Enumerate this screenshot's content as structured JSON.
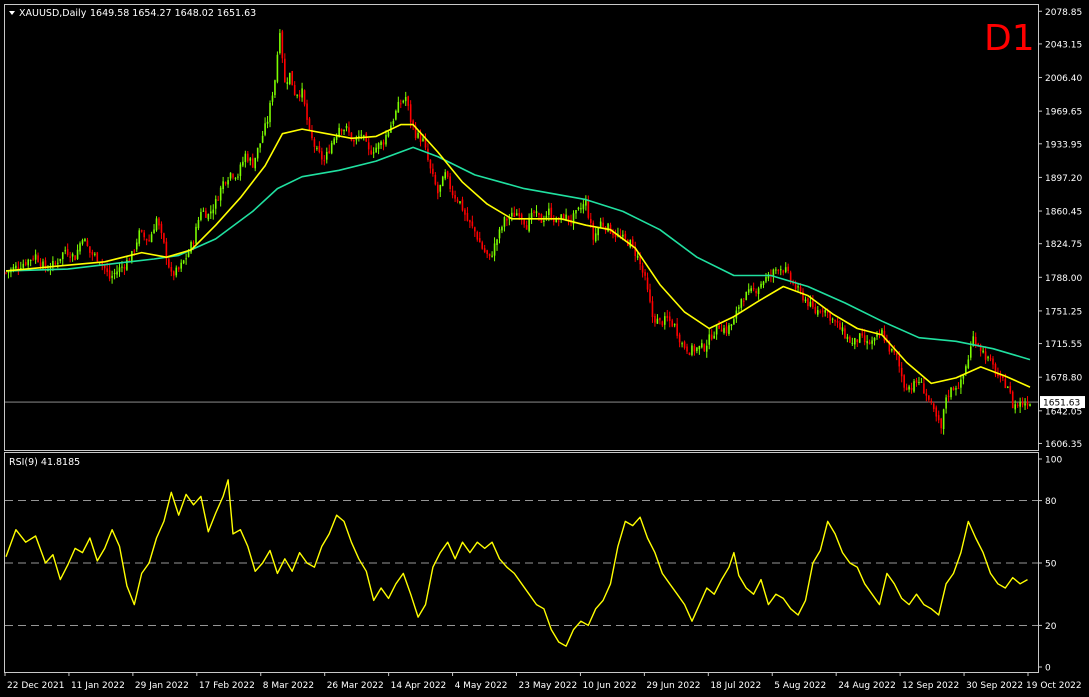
{
  "header": {
    "symbol": "XAUUSD,Daily",
    "ohlc": "1649.58 1654.27 1648.02 1651.63",
    "timeframe_badge": "D1"
  },
  "colors": {
    "background": "#000000",
    "frame": "#c8c8c8",
    "bull": "#7CFC00",
    "bear": "#FF0000",
    "ma_fast": "#FFFF00",
    "ma_slow": "#20E0A0",
    "rsi": "#FFFF00",
    "badge": "#FF0000",
    "price_line": "#A0A0A0"
  },
  "chart_data": [
    {
      "type": "candlestick",
      "title": "XAUUSD,Daily",
      "ylim": [
        1600,
        2085
      ],
      "yticks": [
        "2078.85",
        "2043.15",
        "2006.40",
        "1969.65",
        "1933.95",
        "1897.20",
        "1860.45",
        "1824.75",
        "1788.00",
        "1751.25",
        "1715.55",
        "1678.80",
        "1642.05",
        "1606.35"
      ],
      "last_price": "1651.63",
      "x_labels": [
        "22 Dec 2021",
        "11 Jan 2022",
        "29 Jan 2022",
        "17 Feb 2022",
        "8 Mar 2022",
        "26 Mar 2022",
        "14 Apr 2022",
        "4 May 2022",
        "23 May 2022",
        "10 Jun 2022",
        "29 Jun 2022",
        "18 Jul 2022",
        "5 Aug 2022",
        "24 Aug 2022",
        "12 Sep 2022",
        "30 Sep 2022",
        "19 Oct 2022"
      ],
      "close_path": [
        [
          0,
          1793
        ],
        [
          8,
          1805
        ],
        [
          12,
          1812
        ],
        [
          16,
          1797
        ],
        [
          20,
          1803
        ],
        [
          24,
          1818
        ],
        [
          28,
          1810
        ],
        [
          31,
          1833
        ],
        [
          34,
          1815
        ],
        [
          38,
          1808
        ],
        [
          42,
          1787
        ],
        [
          45,
          1795
        ],
        [
          48,
          1802
        ],
        [
          51,
          1812
        ],
        [
          54,
          1836
        ],
        [
          58,
          1828
        ],
        [
          61,
          1852
        ],
        [
          64,
          1823
        ],
        [
          67,
          1790
        ],
        [
          70,
          1796
        ],
        [
          73,
          1810
        ],
        [
          76,
          1829
        ],
        [
          79,
          1862
        ],
        [
          82,
          1856
        ],
        [
          85,
          1870
        ],
        [
          88,
          1892
        ],
        [
          91,
          1902
        ],
        [
          94,
          1900
        ],
        [
          97,
          1922
        ],
        [
          100,
          1912
        ],
        [
          103,
          1935
        ],
        [
          106,
          1960
        ],
        [
          109,
          2005
        ],
        [
          111,
          2060
        ],
        [
          113,
          2000
        ],
        [
          115,
          2010
        ],
        [
          117,
          1990
        ],
        [
          120,
          1990
        ],
        [
          123,
          1945
        ],
        [
          126,
          1925
        ],
        [
          129,
          1915
        ],
        [
          132,
          1935
        ],
        [
          135,
          1953
        ],
        [
          138,
          1950
        ],
        [
          141,
          1935
        ],
        [
          144,
          1945
        ],
        [
          147,
          1925
        ],
        [
          150,
          1930
        ],
        [
          153,
          1937
        ],
        [
          156,
          1955
        ],
        [
          159,
          1975
        ],
        [
          162,
          1985
        ],
        [
          164,
          1960
        ],
        [
          166,
          1945
        ],
        [
          169,
          1937
        ],
        [
          172,
          1905
        ],
        [
          175,
          1880
        ],
        [
          178,
          1900
        ],
        [
          181,
          1880
        ],
        [
          184,
          1870
        ],
        [
          187,
          1850
        ],
        [
          190,
          1838
        ],
        [
          193,
          1820
        ],
        [
          196,
          1808
        ],
        [
          199,
          1830
        ],
        [
          202,
          1850
        ],
        [
          205,
          1855
        ],
        [
          208,
          1860
        ],
        [
          211,
          1845
        ],
        [
          214,
          1858
        ],
        [
          217,
          1850
        ],
        [
          220,
          1860
        ],
        [
          223,
          1848
        ],
        [
          226,
          1855
        ],
        [
          229,
          1850
        ],
        [
          232,
          1860
        ],
        [
          235,
          1870
        ],
        [
          238,
          1830
        ],
        [
          241,
          1848
        ],
        [
          244,
          1842
        ],
        [
          247,
          1835
        ],
        [
          250,
          1830
        ],
        [
          253,
          1825
        ],
        [
          256,
          1810
        ],
        [
          259,
          1785
        ],
        [
          262,
          1745
        ],
        [
          265,
          1738
        ],
        [
          268,
          1742
        ],
        [
          271,
          1735
        ],
        [
          274,
          1715
        ],
        [
          277,
          1708
        ],
        [
          280,
          1710
        ],
        [
          283,
          1712
        ],
        [
          286,
          1725
        ],
        [
          289,
          1735
        ],
        [
          292,
          1730
        ],
        [
          295,
          1740
        ],
        [
          298,
          1765
        ],
        [
          301,
          1770
        ],
        [
          304,
          1775
        ],
        [
          307,
          1785
        ],
        [
          310,
          1790
        ],
        [
          313,
          1800
        ],
        [
          316,
          1795
        ],
        [
          319,
          1780
        ],
        [
          322,
          1770
        ],
        [
          325,
          1760
        ],
        [
          328,
          1750
        ],
        [
          331,
          1755
        ],
        [
          334,
          1745
        ],
        [
          337,
          1735
        ],
        [
          340,
          1725
        ],
        [
          343,
          1715
        ],
        [
          346,
          1722
        ],
        [
          349,
          1715
        ],
        [
          352,
          1718
        ],
        [
          355,
          1728
        ],
        [
          358,
          1710
        ],
        [
          361,
          1700
        ],
        [
          364,
          1670
        ],
        [
          367,
          1668
        ],
        [
          370,
          1675
        ],
        [
          373,
          1660
        ],
        [
          376,
          1640
        ],
        [
          379,
          1622
        ],
        [
          381,
          1658
        ],
        [
          384,
          1668
        ],
        [
          387,
          1672
        ],
        [
          390,
          1700
        ],
        [
          392,
          1722
        ],
        [
          394,
          1715
        ],
        [
          397,
          1702
        ],
        [
          400,
          1690
        ],
        [
          403,
          1675
        ],
        [
          406,
          1670
        ],
        [
          408,
          1648
        ],
        [
          411,
          1650
        ],
        [
          414,
          1652
        ]
      ],
      "ma_fast": [
        [
          0,
          1795
        ],
        [
          20,
          1800
        ],
        [
          40,
          1805
        ],
        [
          55,
          1815
        ],
        [
          65,
          1810
        ],
        [
          75,
          1818
        ],
        [
          85,
          1845
        ],
        [
          95,
          1875
        ],
        [
          105,
          1910
        ],
        [
          112,
          1945
        ],
        [
          120,
          1950
        ],
        [
          130,
          1945
        ],
        [
          140,
          1940
        ],
        [
          150,
          1942
        ],
        [
          160,
          1955
        ],
        [
          165,
          1955
        ],
        [
          175,
          1925
        ],
        [
          185,
          1892
        ],
        [
          195,
          1868
        ],
        [
          205,
          1852
        ],
        [
          215,
          1852
        ],
        [
          225,
          1852
        ],
        [
          235,
          1845
        ],
        [
          245,
          1840
        ],
        [
          255,
          1820
        ],
        [
          265,
          1780
        ],
        [
          275,
          1750
        ],
        [
          285,
          1732
        ],
        [
          295,
          1745
        ],
        [
          305,
          1762
        ],
        [
          315,
          1778
        ],
        [
          325,
          1768
        ],
        [
          335,
          1748
        ],
        [
          345,
          1732
        ],
        [
          355,
          1725
        ],
        [
          365,
          1695
        ],
        [
          375,
          1672
        ],
        [
          385,
          1678
        ],
        [
          395,
          1690
        ],
        [
          405,
          1680
        ],
        [
          415,
          1668
        ]
      ],
      "ma_slow": [
        [
          0,
          1795
        ],
        [
          25,
          1797
        ],
        [
          50,
          1805
        ],
        [
          60,
          1808
        ],
        [
          70,
          1812
        ],
        [
          85,
          1830
        ],
        [
          100,
          1860
        ],
        [
          110,
          1885
        ],
        [
          120,
          1898
        ],
        [
          135,
          1905
        ],
        [
          150,
          1915
        ],
        [
          165,
          1930
        ],
        [
          175,
          1920
        ],
        [
          190,
          1900
        ],
        [
          210,
          1885
        ],
        [
          235,
          1873
        ],
        [
          250,
          1860
        ],
        [
          265,
          1840
        ],
        [
          280,
          1810
        ],
        [
          295,
          1790
        ],
        [
          310,
          1790
        ],
        [
          325,
          1778
        ],
        [
          340,
          1760
        ],
        [
          355,
          1740
        ],
        [
          370,
          1722
        ],
        [
          385,
          1718
        ],
        [
          400,
          1710
        ],
        [
          415,
          1698
        ]
      ]
    },
    {
      "type": "line",
      "title": "RSI(9) 41.8185",
      "ylim": [
        0,
        100
      ],
      "yticks": [
        "100",
        "80",
        "50",
        "20",
        "0"
      ],
      "levels": [
        80,
        50,
        20
      ],
      "values": [
        [
          0,
          53
        ],
        [
          4,
          66
        ],
        [
          8,
          60
        ],
        [
          12,
          63
        ],
        [
          16,
          50
        ],
        [
          19,
          54
        ],
        [
          22,
          42
        ],
        [
          25,
          49
        ],
        [
          28,
          57
        ],
        [
          31,
          55
        ],
        [
          34,
          62
        ],
        [
          37,
          51
        ],
        [
          40,
          57
        ],
        [
          43,
          66
        ],
        [
          46,
          58
        ],
        [
          49,
          39
        ],
        [
          52,
          30
        ],
        [
          55,
          45
        ],
        [
          58,
          50
        ],
        [
          61,
          62
        ],
        [
          64,
          70
        ],
        [
          67,
          84
        ],
        [
          70,
          73
        ],
        [
          73,
          83
        ],
        [
          76,
          78
        ],
        [
          79,
          82
        ],
        [
          82,
          65
        ],
        [
          85,
          74
        ],
        [
          88,
          82
        ],
        [
          90,
          90
        ],
        [
          92,
          64
        ],
        [
          95,
          66
        ],
        [
          98,
          58
        ],
        [
          101,
          46
        ],
        [
          104,
          50
        ],
        [
          107,
          56
        ],
        [
          110,
          45
        ],
        [
          113,
          52
        ],
        [
          116,
          46
        ],
        [
          119,
          55
        ],
        [
          122,
          50
        ],
        [
          125,
          48
        ],
        [
          128,
          58
        ],
        [
          131,
          64
        ],
        [
          134,
          73
        ],
        [
          137,
          70
        ],
        [
          140,
          60
        ],
        [
          143,
          52
        ],
        [
          146,
          46
        ],
        [
          149,
          32
        ],
        [
          152,
          38
        ],
        [
          155,
          33
        ],
        [
          158,
          40
        ],
        [
          161,
          45
        ],
        [
          164,
          35
        ],
        [
          167,
          24
        ],
        [
          170,
          30
        ],
        [
          173,
          48
        ],
        [
          176,
          55
        ],
        [
          179,
          60
        ],
        [
          182,
          52
        ],
        [
          185,
          60
        ],
        [
          188,
          55
        ],
        [
          191,
          60
        ],
        [
          194,
          57
        ],
        [
          197,
          60
        ],
        [
          200,
          52
        ],
        [
          203,
          48
        ],
        [
          206,
          45
        ],
        [
          209,
          40
        ],
        [
          212,
          35
        ],
        [
          215,
          30
        ],
        [
          218,
          28
        ],
        [
          221,
          18
        ],
        [
          224,
          12
        ],
        [
          227,
          10
        ],
        [
          230,
          18
        ],
        [
          233,
          22
        ],
        [
          236,
          20
        ],
        [
          239,
          28
        ],
        [
          242,
          32
        ],
        [
          245,
          40
        ],
        [
          248,
          58
        ],
        [
          251,
          70
        ],
        [
          254,
          68
        ],
        [
          257,
          72
        ],
        [
          260,
          62
        ],
        [
          263,
          55
        ],
        [
          266,
          45
        ],
        [
          269,
          40
        ],
        [
          272,
          35
        ],
        [
          275,
          30
        ],
        [
          278,
          22
        ],
        [
          281,
          30
        ],
        [
          284,
          38
        ],
        [
          287,
          35
        ],
        [
          290,
          42
        ],
        [
          293,
          48
        ],
        [
          295,
          55
        ],
        [
          297,
          44
        ],
        [
          300,
          38
        ],
        [
          303,
          35
        ],
        [
          306,
          42
        ],
        [
          309,
          30
        ],
        [
          312,
          35
        ],
        [
          315,
          33
        ],
        [
          318,
          28
        ],
        [
          321,
          25
        ],
        [
          324,
          32
        ],
        [
          327,
          50
        ],
        [
          330,
          56
        ],
        [
          333,
          70
        ],
        [
          336,
          64
        ],
        [
          339,
          55
        ],
        [
          342,
          50
        ],
        [
          345,
          48
        ],
        [
          348,
          40
        ],
        [
          351,
          35
        ],
        [
          354,
          30
        ],
        [
          357,
          45
        ],
        [
          360,
          40
        ],
        [
          363,
          33
        ],
        [
          366,
          30
        ],
        [
          369,
          35
        ],
        [
          372,
          30
        ],
        [
          375,
          28
        ],
        [
          378,
          25
        ],
        [
          381,
          40
        ],
        [
          384,
          45
        ],
        [
          387,
          55
        ],
        [
          390,
          70
        ],
        [
          393,
          62
        ],
        [
          396,
          55
        ],
        [
          399,
          45
        ],
        [
          402,
          40
        ],
        [
          405,
          38
        ],
        [
          408,
          43
        ],
        [
          411,
          40
        ],
        [
          414,
          42
        ]
      ]
    }
  ]
}
